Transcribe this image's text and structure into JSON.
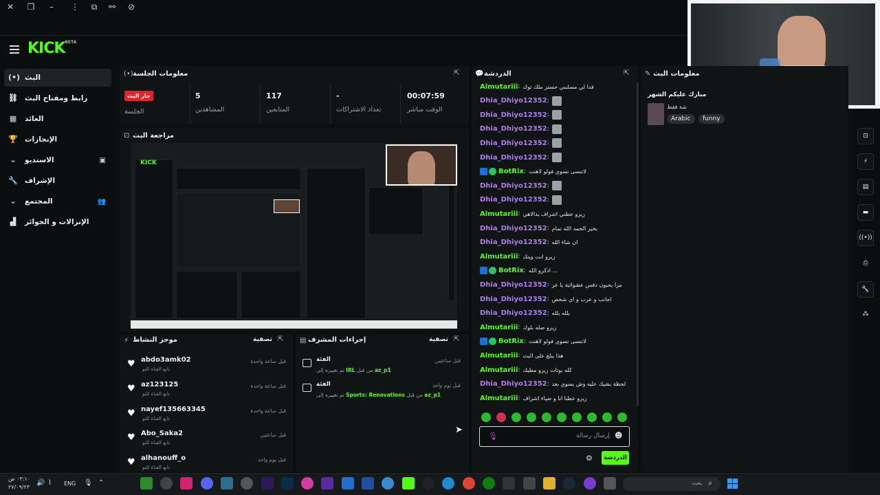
{
  "header": {
    "logo": "KICK",
    "logo_sup": "BETA"
  },
  "nav": [
    {
      "label": "البث",
      "icon": "live-icon",
      "glyph": "(•)"
    },
    {
      "label": "رابط ومفتاح البث",
      "icon": "link-icon",
      "glyph": "⛓"
    },
    {
      "label": "العائد",
      "icon": "revenue-icon",
      "glyph": "▦"
    },
    {
      "label": "الإنجازات",
      "icon": "trophy-icon",
      "glyph": "🏆"
    },
    {
      "label": "الاستديو",
      "icon": "chevron-down-icon",
      "glyph": "⌄"
    },
    {
      "label": "الإشراف",
      "icon": "wrench-icon",
      "glyph": "🔧"
    },
    {
      "label": "المجتمع",
      "icon": "chevron-down-icon",
      "glyph": "⌄"
    },
    {
      "label": "الإنزالات و الجوائز",
      "icon": "gift-icon",
      "glyph": "▟"
    }
  ],
  "session": {
    "title": "معلومات الجلسة",
    "live_badge": "جار البث",
    "stats": [
      {
        "value": "",
        "label": "الجلسة"
      },
      {
        "value": "5",
        "label": "المشاهدين"
      },
      {
        "value": "117",
        "label": "المتابعين"
      },
      {
        "value": "-",
        "label": "تعداد الاشتراكات"
      },
      {
        "value": "00:07:59",
        "label": "الوقت مباشر"
      }
    ]
  },
  "preview": {
    "title": "مراجعة البث",
    "mini_logo": "KICK"
  },
  "activity": {
    "title": "موجز النشاط",
    "filter": "تصفية",
    "items": [
      {
        "user": "abdo3amk02",
        "sub": "تابع القناة للتو",
        "time": "قبل ساعة واحدة"
      },
      {
        "user": "az123125",
        "sub": "تابع القناة للتو",
        "time": "قبل ساعة واحدة"
      },
      {
        "user": "nayef135663345",
        "sub": "تابع القناة للتو",
        "time": "قبل ساعة واحدة"
      },
      {
        "user": "Abo_Saka2",
        "sub": "تابع القناة للتو",
        "time": "قبل ساعتين"
      },
      {
        "user": "alhanouff_o",
        "sub": "تابع القناة للتو",
        "time": "قبل يوم واحد"
      }
    ]
  },
  "moderation": {
    "title": "إجراءات المشرف",
    "filter": "تصفية",
    "items": [
      {
        "title": "الفئة",
        "pre": "تم تغييره إلى",
        "cat": "IRL",
        "mid": "من قبل",
        "by": "az_p1",
        "time": "قبل ساعتين"
      },
      {
        "title": "الفئة",
        "pre": "تم تغييره إلى",
        "cat": "Sports: Renovations",
        "mid": "من قبل",
        "by": "az_p1",
        "time": "قبل يوم واحد"
      }
    ]
  },
  "chat": {
    "title": "الدردشة",
    "messages": [
      {
        "user": "Almutariii",
        "color": "green",
        "text": "فدا لي مسلبني حستر ملك توك",
        "emote": false,
        "bot": false
      },
      {
        "user": "Dhia_Dhiyo12352",
        "color": "purple",
        "text": "",
        "emote": true,
        "bot": false
      },
      {
        "user": "Dhia_Dhiyo12352",
        "color": "purple",
        "text": "",
        "emote": true,
        "bot": false
      },
      {
        "user": "Dhia_Dhiyo12352",
        "color": "purple",
        "text": "",
        "emote": true,
        "bot": false
      },
      {
        "user": "Dhia_Dhiyo12352",
        "color": "purple",
        "text": "",
        "emote": true,
        "bot": false
      },
      {
        "user": "Dhia_Dhiyo12352",
        "color": "purple",
        "text": "",
        "emote": true,
        "bot": false
      },
      {
        "user": "BotRix",
        "color": "green",
        "text": "لاتنسى تسوي فولو لاهنت",
        "emote": false,
        "bot": true
      },
      {
        "user": "Dhia_Dhiyo12352",
        "color": "purple",
        "text": "",
        "emote": true,
        "bot": false
      },
      {
        "user": "Dhia_Dhiyo12352",
        "color": "purple",
        "text": "",
        "emote": true,
        "bot": false
      },
      {
        "user": "Almutariii",
        "color": "green",
        "text": "زيزو عطني اشراف بدالاهي",
        "emote": false,
        "bot": false
      },
      {
        "user": "Dhia_Dhiyo12352",
        "color": "purple",
        "text": "بخير الحمد الله تمام",
        "emote": false,
        "bot": false
      },
      {
        "user": "Dhia_Dhiyo12352",
        "color": "purple",
        "text": "ان شاء الله",
        "emote": false,
        "bot": false
      },
      {
        "user": "Almutariii",
        "color": "green",
        "text": "زيزو انت وينك",
        "emote": false,
        "bot": false
      },
      {
        "user": "BotRix",
        "color": "green",
        "text": "اذكرو الله ...",
        "emote": false,
        "bot": true
      },
      {
        "user": "Dhia_Dhiyo12352",
        "color": "purple",
        "text": "مرا يحبون دفس عشوائية يا عز",
        "emote": false,
        "bot": false
      },
      {
        "user": "Dhia_Dhiyo12352",
        "color": "purple",
        "text": "اجانب و عرب و اي شخص",
        "emote": false,
        "bot": false
      },
      {
        "user": "Dhia_Dhiyo12352",
        "color": "purple",
        "text": "بلله بلله",
        "emote": false,
        "bot": false
      },
      {
        "user": "Almutariii",
        "color": "green",
        "text": "زيزو صله بلوك",
        "emote": false,
        "bot": false
      },
      {
        "user": "BotRix",
        "color": "green",
        "text": "لاتنسى تسوي فولو لاهنت",
        "emote": false,
        "bot": true
      },
      {
        "user": "Almutariii",
        "color": "green",
        "text": "هذا يبلغ على البث",
        "emote": false,
        "bot": false
      },
      {
        "user": "Almutariii",
        "color": "green",
        "text": "كله بوتات زيزو مطيك",
        "emote": false,
        "bot": false
      },
      {
        "user": "Dhia_Dhiyo12352",
        "color": "purple",
        "text": "لحظة بشيك عليه وش يسوي بعد",
        "emote": false,
        "bot": false
      },
      {
        "user": "Almutariii",
        "color": "green",
        "text": "زيزو عطنا انا و ضياء اشراف",
        "emote": false,
        "bot": false
      }
    ],
    "input_placeholder": "إرسال رسالة",
    "send_label": "الدردشة"
  },
  "stream_info": {
    "title": "معلومات البث",
    "stream_title": "مبارك عليكم الشهر",
    "category": "شة فقط",
    "tags": [
      "Arabic",
      "funny"
    ]
  },
  "taskbar": {
    "time": "٠٣:١٠ ص",
    "date": "٢٧/٠٩/٢٣",
    "lang": "ENG",
    "search_placeholder": "بحث"
  },
  "colors": {
    "brand": "#53fc18",
    "live": "#e0242c",
    "chat_purple": "#b17cf0"
  }
}
